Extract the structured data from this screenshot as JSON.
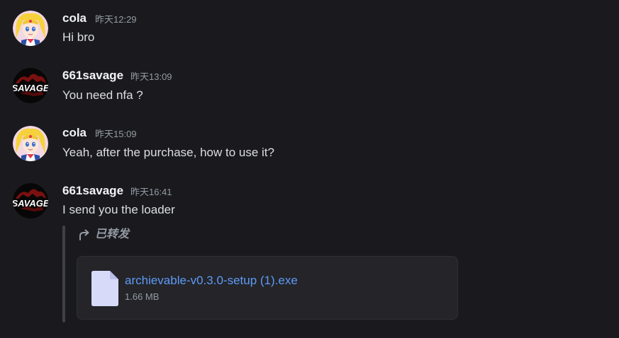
{
  "messages": [
    {
      "author": "cola",
      "time": "昨天12:29",
      "text": "Hi bro",
      "avatar_icon": "sailor-moon-avatar"
    },
    {
      "author": "661savage",
      "time": "昨天13:09",
      "text": "You need nfa ?",
      "avatar_icon": "savage-logo-avatar"
    },
    {
      "author": "cola",
      "time": "昨天15:09",
      "text": "Yeah, after the purchase, how to use it?",
      "avatar_icon": "sailor-moon-avatar"
    },
    {
      "author": "661savage",
      "time": "昨天16:41",
      "text": "I send you the loader",
      "avatar_icon": "savage-logo-avatar"
    }
  ],
  "forward": {
    "label": "已转发",
    "icon": "forward-arrow-icon",
    "attachment": {
      "file_name": "archievable-v0.3.0-setup (1).exe",
      "file_size": "1.66 MB",
      "icon": "file-icon"
    }
  },
  "avatars": {
    "savage_text": "SAVAGE"
  },
  "colors": {
    "background": "#1a1a1e",
    "link": "#5e9bf5",
    "muted": "#949ba4"
  }
}
